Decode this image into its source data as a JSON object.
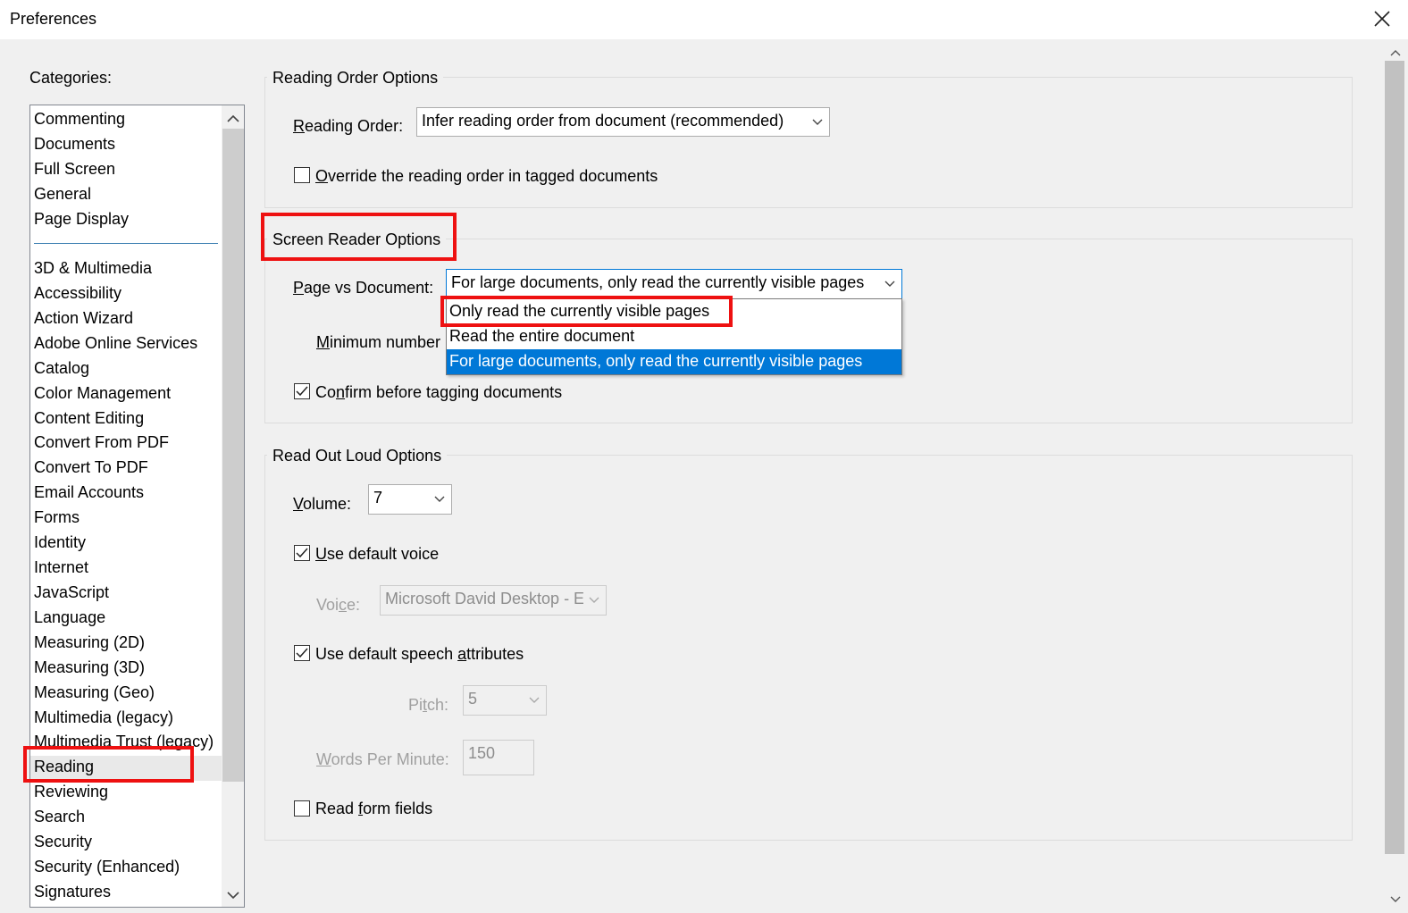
{
  "window": {
    "title": "Preferences"
  },
  "categories": {
    "label": "Categories:",
    "top_items": [
      "Commenting",
      "Documents",
      "Full Screen",
      "General",
      "Page Display"
    ],
    "items": [
      "3D & Multimedia",
      "Accessibility",
      "Action Wizard",
      "Adobe Online Services",
      "Catalog",
      "Color Management",
      "Content Editing",
      "Convert From PDF",
      "Convert To PDF",
      "Email Accounts",
      "Forms",
      "Identity",
      "Internet",
      "JavaScript",
      "Language",
      "Measuring (2D)",
      "Measuring (3D)",
      "Measuring (Geo)",
      "Multimedia (legacy)",
      "Multimedia Trust (legacy)",
      "Reading",
      "Reviewing",
      "Search",
      "Security",
      "Security (Enhanced)",
      "Signatures"
    ],
    "selected": "Reading"
  },
  "reading_order": {
    "title": "Reading Order Options",
    "label_prefix": "R",
    "label_rest": "eading Order:",
    "value": "Infer reading order from document (recommended)",
    "override_prefix": "O",
    "override_rest": "verride the reading order in tagged documents",
    "override_checked": false
  },
  "screen_reader": {
    "title": "Screen Reader Options",
    "page_vs_doc_prefix": "P",
    "page_vs_doc_rest": "age vs Document:",
    "page_vs_doc_value": "For large documents, only read the currently visible pages",
    "options": [
      "Only read the currently visible pages",
      "Read the entire document",
      "For large documents, only read the currently visible pages"
    ],
    "min_prefix": "M",
    "min_rest": "inimum number",
    "confirm_a": "Co",
    "confirm_u": "n",
    "confirm_b": "firm before tagging documents",
    "confirm_checked": true
  },
  "read_out_loud": {
    "title": "Read Out Loud Options",
    "volume_prefix": "V",
    "volume_rest": "olume:",
    "volume_value": "7",
    "use_default_voice_prefix": "U",
    "use_default_voice_rest": "se default voice",
    "voice_a": "Voi",
    "voice_u": "c",
    "voice_b": "e:",
    "voice_value": "Microsoft David Desktop - E",
    "speech_attr_a": "Use default speech ",
    "speech_attr_u": "a",
    "speech_attr_b": "ttributes",
    "pitch_a": "Pi",
    "pitch_u": "t",
    "pitch_b": "ch:",
    "pitch_value": "5",
    "wpm_prefix": "W",
    "wpm_rest": "ords Per Minute:",
    "wpm_value": "150",
    "form_fields_a": "Read ",
    "form_fields_u": "f",
    "form_fields_b": "orm fields"
  },
  "colors": {
    "highlight": "#0078d7",
    "annotation": "#ee1111"
  }
}
